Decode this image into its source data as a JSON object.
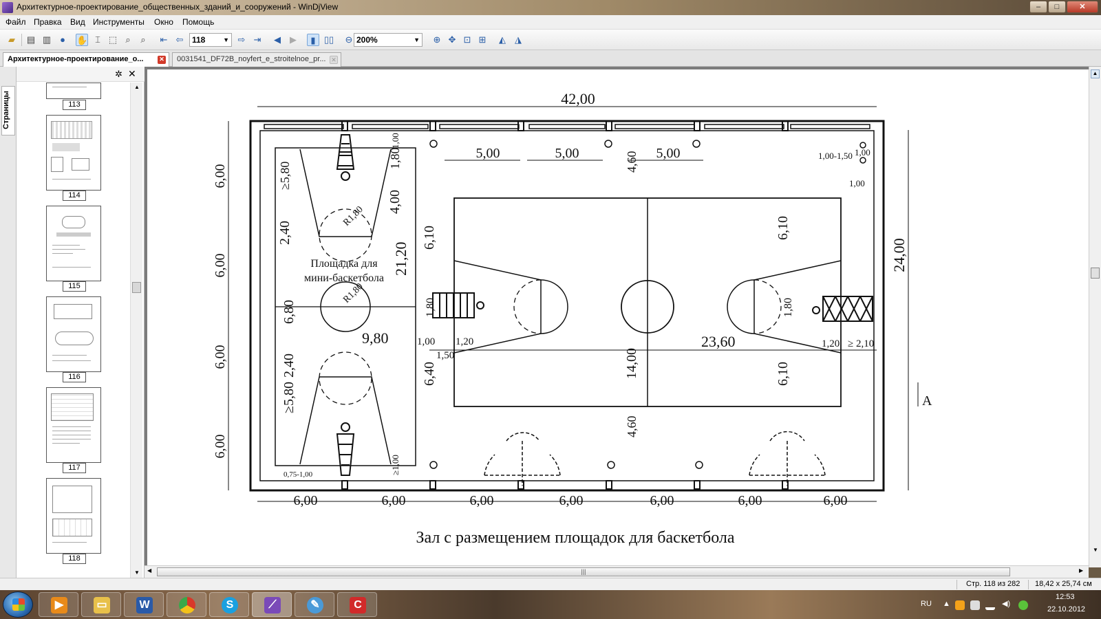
{
  "window": {
    "title": "Архитектурное-проектирование_общественных_зданий_и_сооружений - WinDjView",
    "controls": {
      "minimize": "–",
      "maximize": "□",
      "close": "✕"
    }
  },
  "menu": [
    "Файл",
    "Правка",
    "Вид",
    "Инструменты",
    "Окно",
    "Помощь"
  ],
  "toolbar": {
    "page_number": "118",
    "zoom": "200%",
    "icons": [
      "open-icon",
      "print-icon",
      "save-icon",
      "info-icon",
      "hand-icon",
      "select-text-icon",
      "select-rect-icon",
      "zoom-rect-icon",
      "find-icon",
      "first-page-icon",
      "prev-page-icon",
      "next-page-icon",
      "last-page-icon",
      "back-icon",
      "forward-icon",
      "single-page-icon",
      "facing-pages-icon",
      "zoom-out-icon",
      "zoom-in-icon",
      "fit-page-icon",
      "fit-width-icon",
      "actual-size-icon",
      "rotate-left-icon",
      "rotate-right-icon"
    ]
  },
  "tabs": [
    {
      "label": "Архитектурное-проектирование_о...",
      "active": true
    },
    {
      "label": "0031541_DF72B_noyfert_e_stroitelnoe_pr...",
      "active": false
    }
  ],
  "sidebar": {
    "vertical_tab": "Страницы",
    "thumbnails": [
      "113",
      "114",
      "115",
      "116",
      "117",
      "118"
    ]
  },
  "drawing": {
    "caption": "Зал с размещением площадок для баскетбола",
    "court_label_1": "Площадка для",
    "court_label_2": "мини-баскетбола",
    "top_total": "42,00",
    "top_spans": [
      "5,00",
      "5,00",
      "5,00"
    ],
    "bottom_spans": [
      "6,00",
      "6,00",
      "6,00",
      "6,00",
      "6,00",
      "6,00",
      "6,00"
    ],
    "left_spans": [
      "6,00",
      "6,00",
      "6,00",
      "6,00"
    ],
    "right_total": "24,00",
    "section_mark": "A",
    "dims": {
      "d1": "≥5,80",
      "d2": "1,80",
      "d3": "4,00",
      "d4": "2,40",
      "d5": "21,20",
      "d6": "6,80",
      "d7": "9,80",
      "d8": "2,40",
      "d9": "≥5,80",
      "d10": "6,10",
      "d11": "1,80",
      "d12": "1,00",
      "d13": "1,20",
      "d14": "1,50",
      "d15": "6,40",
      "d16": "14,00",
      "d17": "4,60",
      "d18": "4,60",
      "d19": "23,60",
      "d20": "6,10",
      "d21": "6,10",
      "d22": "1,80",
      "d23": "1,20",
      "d24": "≥ 2,10",
      "d25": "1,00",
      "d26": "1,00-1,50",
      "d27": "1,00",
      "d28": "R1,80",
      "d29": "R1,80",
      "d30": "1,00",
      "d31": "≥1,00",
      "d32": "0,75-1,00"
    }
  },
  "status": {
    "page": "Стр. 118 из 282",
    "size": "18,42 x 25,74 см"
  },
  "taskbar": {
    "apps": [
      "media-player",
      "explorer",
      "word",
      "chrome",
      "skype",
      "windjview",
      "paint",
      "uniconverter"
    ],
    "lang": "RU",
    "time": "12:53",
    "date": "22.10.2012"
  }
}
